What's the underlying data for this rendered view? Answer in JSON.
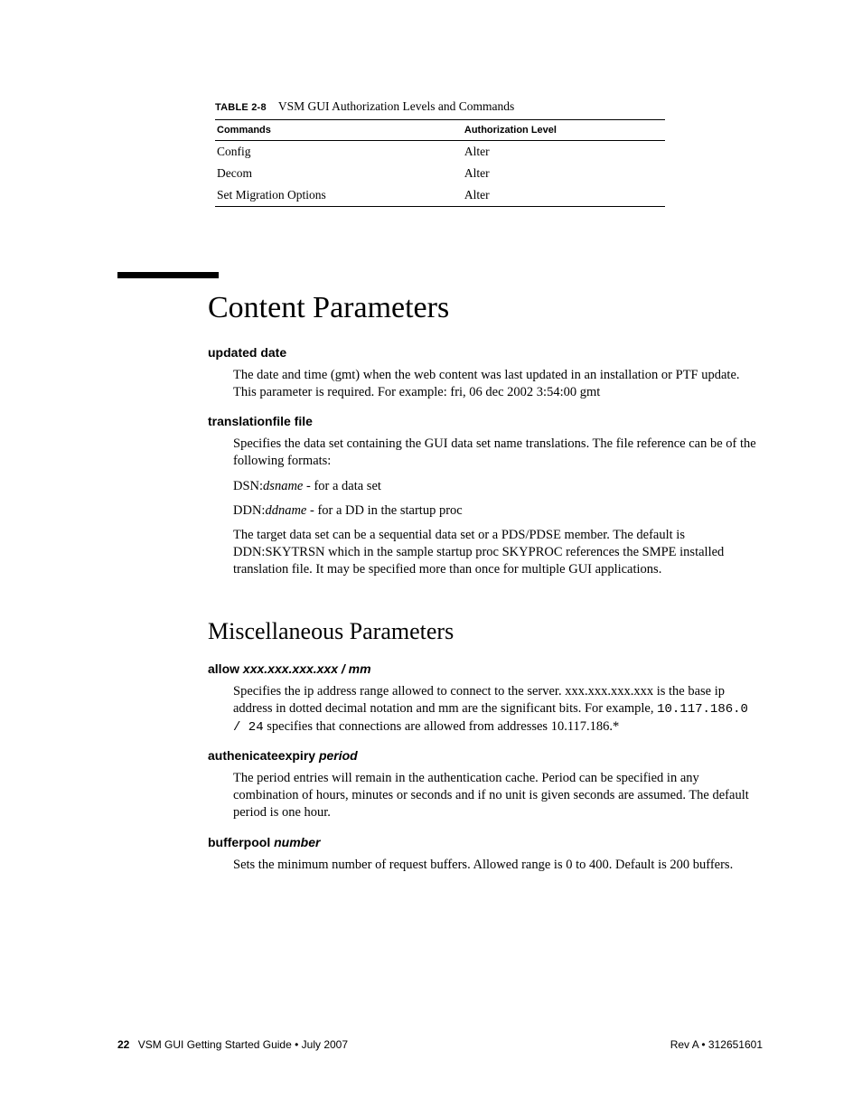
{
  "table": {
    "label": "TABLE 2-8",
    "title": "VSM GUI Authorization Levels and Commands",
    "headers": [
      "Commands",
      "Authorization Level"
    ],
    "rows": [
      [
        "Config",
        "Alter"
      ],
      [
        "Decom",
        "Alter"
      ],
      [
        "Set Migration Options",
        "Alter"
      ]
    ]
  },
  "section1": {
    "heading": "Content Parameters",
    "items": [
      {
        "term_plain": "updated date",
        "paras": [
          "The date and time (gmt) when the web content was last updated in an installation or PTF update. This parameter is required. For example: fri, 06 dec 2002 3:54:00 gmt"
        ]
      },
      {
        "term_plain": "translationfile file",
        "paras_rich": [
          "Specifies the data set containing the GUI data set name translations. The file reference can be of the following formats:",
          {
            "prefix": "DSN:",
            "it": "dsname",
            "suffix": " - for a data set"
          },
          {
            "prefix": "DDN:",
            "it": "ddname",
            "suffix": " - for a DD in the startup proc"
          },
          "The target data set can be a sequential data set or a PDS/PDSE member. The default is DDN:SKYTRSN which in the sample startup proc SKYPROC references the SMPE installed translation file. It may be specified more than once for multiple GUI applications."
        ]
      }
    ]
  },
  "section2": {
    "heading": "Miscellaneous Parameters",
    "items": [
      {
        "term_prefix": "allow ",
        "term_var": "xxx.xxx.xxx.xxx / mm",
        "paras_rich": [
          {
            "text_pre": "Specifies the ip address range allowed to connect to the server. xxx.xxx.xxx.xxx is the base ip address in dotted decimal notation and mm are the significant bits. For example, ",
            "mono": "10.117.186.0 / 24",
            "text_post": " specifies that connections are allowed from addresses 10.117.186.*"
          }
        ]
      },
      {
        "term_prefix": "authenicateexpiry ",
        "term_var": "period",
        "paras": [
          "The period entries will remain in the authentication cache. Period can be specified in any combination of hours, minutes or seconds and if no unit is given seconds are assumed. The default period is one hour."
        ]
      },
      {
        "term_prefix": "bufferpool ",
        "term_var": "number",
        "paras": [
          "Sets the minimum number of request buffers. Allowed range is 0 to 400. Default is 200 buffers."
        ]
      }
    ]
  },
  "footer": {
    "page": "22",
    "left": "VSM GUI Getting Started Guide  •  July 2007",
    "right": "Rev A  •  312651601"
  }
}
